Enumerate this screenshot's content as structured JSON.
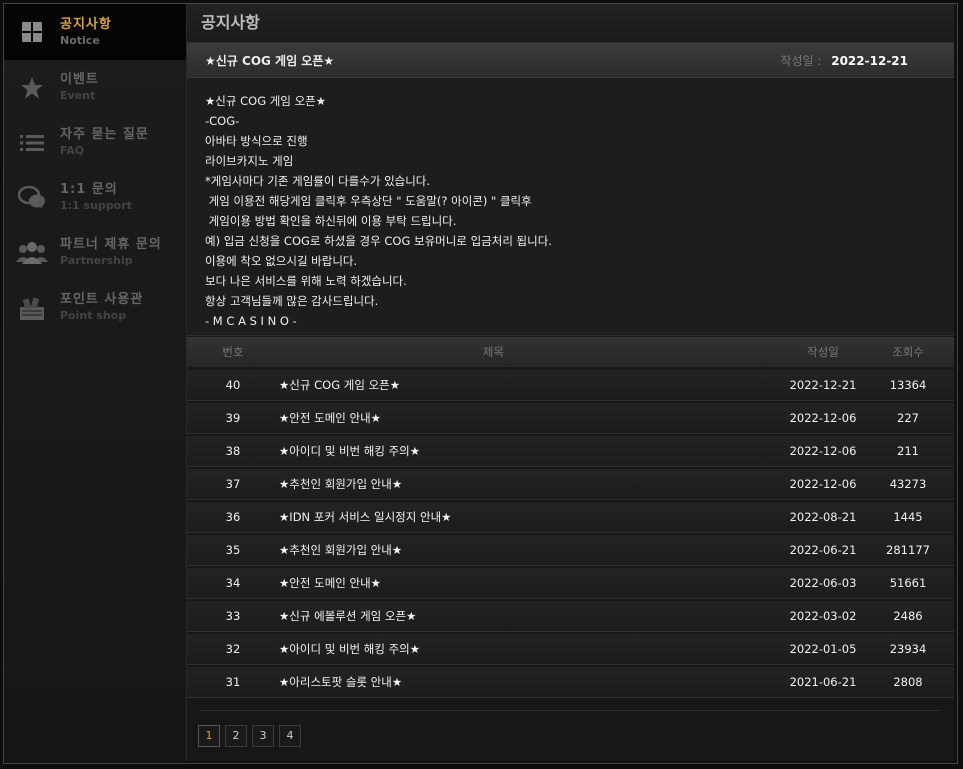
{
  "sidebar": {
    "items": [
      {
        "ko": "공지사항",
        "en": "Notice",
        "icon": "grid-icon",
        "active": true
      },
      {
        "ko": "이벤트",
        "en": "Event",
        "icon": "star-icon",
        "active": false
      },
      {
        "ko": "자주 묻는 질문",
        "en": "FAQ",
        "icon": "list-icon",
        "active": false
      },
      {
        "ko": "1:1 문의",
        "en": "1:1 support",
        "icon": "chat-bubbles-icon",
        "active": false
      },
      {
        "ko": "파트너 제휴 문의",
        "en": "Partnership",
        "icon": "people-icon",
        "active": false
      },
      {
        "ko": "포인트 사용관",
        "en": "Point shop",
        "icon": "shop-icon",
        "active": false
      }
    ]
  },
  "page": {
    "title": "공지사항"
  },
  "post": {
    "title": "★신규 COG 게임 오픈★",
    "date_label": "작성일 :",
    "date": "2022-12-21",
    "body": [
      "★신규 COG 게임 오픈★",
      "-COG-",
      "아바타 방식으로 진행",
      "라이브카지노 게임",
      "*게임사마다 기존 게임률이 다를수가 있습니다.",
      " 게임 이용전 해당게임 클릭후 우측상단 \" 도움말(? 아이콘) \" 클릭후",
      " 게임이용 방법 확인을 하신뒤에 이용 부탁 드립니다.",
      "예) 입금 신청을 COG로 하셨을 경우 COG 보유머니로 입금처리 됩니다.",
      "이용에 착오 없으시길 바랍니다.",
      "보다 나은 서비스를 위해 노력 하겠습니다.",
      "항상 고객님들께 많은 감사드립니다.",
      "- M C A S I N O -"
    ]
  },
  "list": {
    "headers": {
      "num": "번호",
      "title": "제목",
      "date": "작성일",
      "views": "조회수"
    },
    "rows": [
      {
        "num": "40",
        "title": "★신규 COG 게임 오픈★",
        "date": "2022-12-21",
        "views": "13364"
      },
      {
        "num": "39",
        "title": "★안전 도메인 안내★",
        "date": "2022-12-06",
        "views": "227"
      },
      {
        "num": "38",
        "title": "★아이디 및 비번 해킹 주의★",
        "date": "2022-12-06",
        "views": "211"
      },
      {
        "num": "37",
        "title": "★추천인 회원가입 안내★",
        "date": "2022-12-06",
        "views": "43273"
      },
      {
        "num": "36",
        "title": "★IDN 포커 서비스 일시정지 안내★",
        "date": "2022-08-21",
        "views": "1445"
      },
      {
        "num": "35",
        "title": "★추천인 회원가입 안내★",
        "date": "2022-06-21",
        "views": "281177"
      },
      {
        "num": "34",
        "title": "★안전 도메인 안내★",
        "date": "2022-06-03",
        "views": "51661"
      },
      {
        "num": "33",
        "title": "★신규 에볼루션 게임 오픈★",
        "date": "2022-03-02",
        "views": "2486"
      },
      {
        "num": "32",
        "title": "★아이디 및 비번 해킹 주의★",
        "date": "2022-01-05",
        "views": "23934"
      },
      {
        "num": "31",
        "title": "★아리스토팟 슬롯 안내★",
        "date": "2021-06-21",
        "views": "2808"
      }
    ]
  },
  "pagination": {
    "pages": [
      "1",
      "2",
      "3",
      "4"
    ],
    "current": "1"
  },
  "colors": {
    "accent": "#d9a441",
    "bg": "#171717"
  }
}
